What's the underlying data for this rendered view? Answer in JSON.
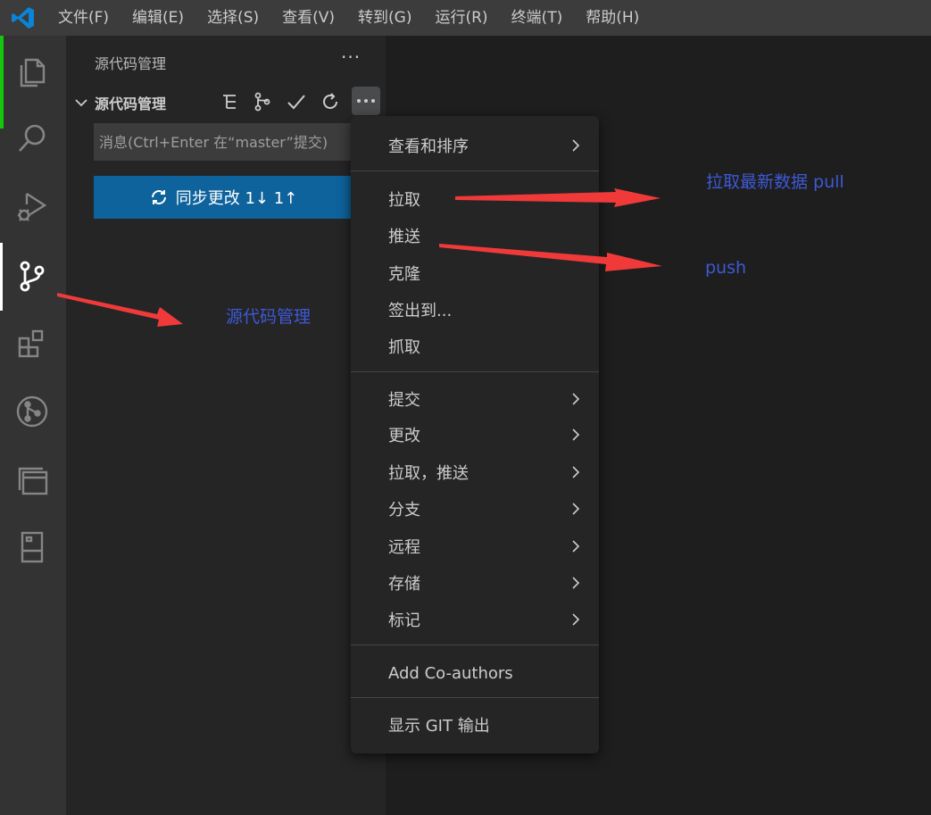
{
  "menubar": {
    "items": [
      "文件(F)",
      "编辑(E)",
      "选择(S)",
      "查看(V)",
      "转到(G)",
      "运行(R)",
      "终端(T)",
      "帮助(H)"
    ]
  },
  "activitybar": {
    "icons": [
      "explorer-icon",
      "search-icon",
      "run-debug-icon",
      "source-control-icon",
      "extensions-icon",
      "git-graph-icon",
      "remote-explorer-icon",
      "book-icon"
    ]
  },
  "sidebar": {
    "title": "源代码管理",
    "more": "···",
    "section_title": "源代码管理",
    "commit_placeholder": "消息(Ctrl+Enter 在“master”提交)",
    "sync_button_label": "同步更改 1↓ 1↑"
  },
  "context_menu": {
    "items": [
      {
        "label": "查看和排序",
        "submenu": true
      },
      {
        "label": "拉取",
        "submenu": false
      },
      {
        "label": "推送",
        "submenu": false
      },
      {
        "label": "克隆",
        "submenu": false
      },
      {
        "label": "签出到...",
        "submenu": false
      },
      {
        "label": "抓取",
        "submenu": false
      },
      {
        "label": "提交",
        "submenu": true
      },
      {
        "label": "更改",
        "submenu": true
      },
      {
        "label": "拉取，推送",
        "submenu": true
      },
      {
        "label": "分支",
        "submenu": true
      },
      {
        "label": "远程",
        "submenu": true
      },
      {
        "label": "存储",
        "submenu": true
      },
      {
        "label": "标记",
        "submenu": true
      },
      {
        "label": "Add Co-authors",
        "submenu": false
      },
      {
        "label": "显示 GIT 输出",
        "submenu": false
      }
    ]
  },
  "annotations": {
    "pull_label": "拉取最新数据 pull",
    "push_label": "push",
    "scm_label": "源代码管理"
  },
  "colors": {
    "accent_button": "#0e639c",
    "annotation_arrow": "#f03a3a",
    "annotation_text": "#3d59d6",
    "activity_indicator": "#16c60c"
  }
}
